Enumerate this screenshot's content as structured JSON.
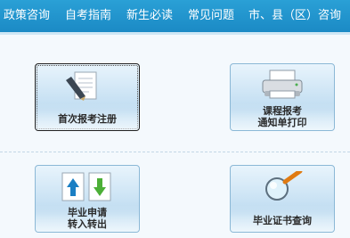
{
  "nav": {
    "items": [
      {
        "label": "政策咨询"
      },
      {
        "label": "自考指南"
      },
      {
        "label": "新生必读"
      },
      {
        "label": "常见问题"
      },
      {
        "label": "市、县（区）咨询"
      }
    ]
  },
  "panels": [
    {
      "label_line1": "首次报考注册",
      "label_line2": "",
      "icon": "pen-document-icon"
    },
    {
      "label_line1": "课程报考",
      "label_line2": "通知单打印",
      "icon": "printer-icon"
    },
    {
      "label_line1": "毕业申请",
      "label_line2": "转入转出",
      "icon": "transfer-documents-icon"
    },
    {
      "label_line1": "毕业证书查询",
      "label_line2": "",
      "icon": "magnifier-icon"
    }
  ]
}
